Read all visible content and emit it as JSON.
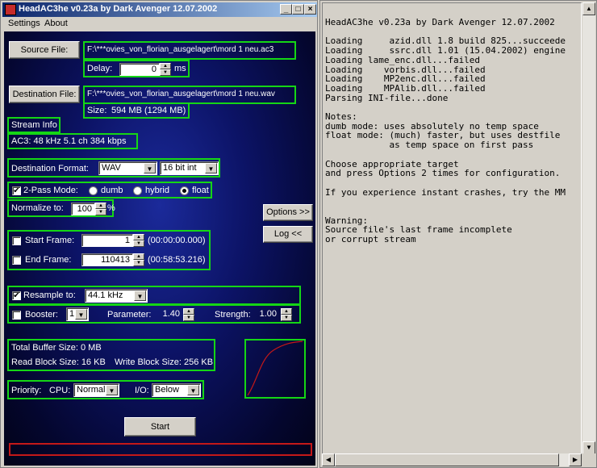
{
  "window": {
    "title": "HeadAC3he v0.23a by Dark Avenger 12.07.2002",
    "controls": {
      "minimize": "_",
      "maximize": "□",
      "close": "×"
    }
  },
  "menu": [
    "Settings",
    "About"
  ],
  "source": {
    "button": "Source File:",
    "path": "F:\\***ovies_von_florian_ausgelagert\\mord 1 neu.ac3"
  },
  "delay": {
    "label": "Delay:",
    "value": "0",
    "unit": "ms"
  },
  "destination": {
    "button": "Destination File:",
    "path": "F:\\***ovies_von_florian_ausgelagert\\mord 1 neu.wav"
  },
  "size": {
    "label": "Size:",
    "value": "594 MB  (1294 MB)"
  },
  "stream": {
    "heading": "Stream Info",
    "info": "AC3:  48 kHz   5.1 ch    384 kbps"
  },
  "format": {
    "label": "Destination Format:",
    "value": "WAV",
    "bits": "16 bit int"
  },
  "pass": {
    "label": "2-Pass Mode:",
    "checked": true,
    "options": [
      "dumb",
      "hybrid",
      "float"
    ],
    "selected": "float"
  },
  "normalize": {
    "label": "Normalize to:",
    "value": "100",
    "unit": "%"
  },
  "side_buttons": {
    "options": "Options >>",
    "log": "Log <<"
  },
  "frames": {
    "start_label": "Start Frame:",
    "start_value": "1",
    "start_time": "(00:00:00.000)",
    "end_label": "End Frame:",
    "end_value": "110413",
    "end_time": "(00:58:53.216)"
  },
  "resample": {
    "label": "Resample to:",
    "value": "44.1 kHz",
    "checked": true
  },
  "booster": {
    "label": "Booster:",
    "value": "1",
    "param_label": "Parameter:",
    "param_value": "1.40",
    "strength_label": "Strength:",
    "strength_value": "1.00"
  },
  "buffer": {
    "total": "Total Buffer Size:    0 MB",
    "read": "Read Block Size:  16 KB",
    "write": "Write Block Size:  256 KB"
  },
  "priority": {
    "label": "Priority:",
    "cpu_label": "CPU:",
    "cpu_value": "Normal",
    "io_label": "I/O:",
    "io_value": "Below"
  },
  "start_button": "Start",
  "colors": {
    "group_border": "#15d615",
    "progress_border": "#c41818",
    "curve": "#c41818"
  },
  "log_lines": [
    "HeadAC3he v0.23a by Dark Avenger 12.07.2002",
    "",
    "Loading     azid.dll 1.8 build 825...succeede",
    "Loading     ssrc.dll 1.01 (15.04.2002) engine",
    "Loading lame_enc.dll...failed",
    "Loading    vorbis.dll...failed",
    "Loading    MP2enc.dll...failed",
    "Loading    MPAlib.dll...failed",
    "Parsing INI-file...done",
    "",
    "Notes:",
    "dumb mode: uses absolutely no temp space",
    "float mode: (much) faster, but uses destfile",
    "            as temp space on first pass",
    "",
    "Choose appropriate target",
    "and press Options 2 times for configuration.",
    "",
    "If you experience instant crashes, try the MM",
    "",
    "",
    "Warning:",
    "Source file's last frame incomplete",
    "or corrupt stream"
  ]
}
